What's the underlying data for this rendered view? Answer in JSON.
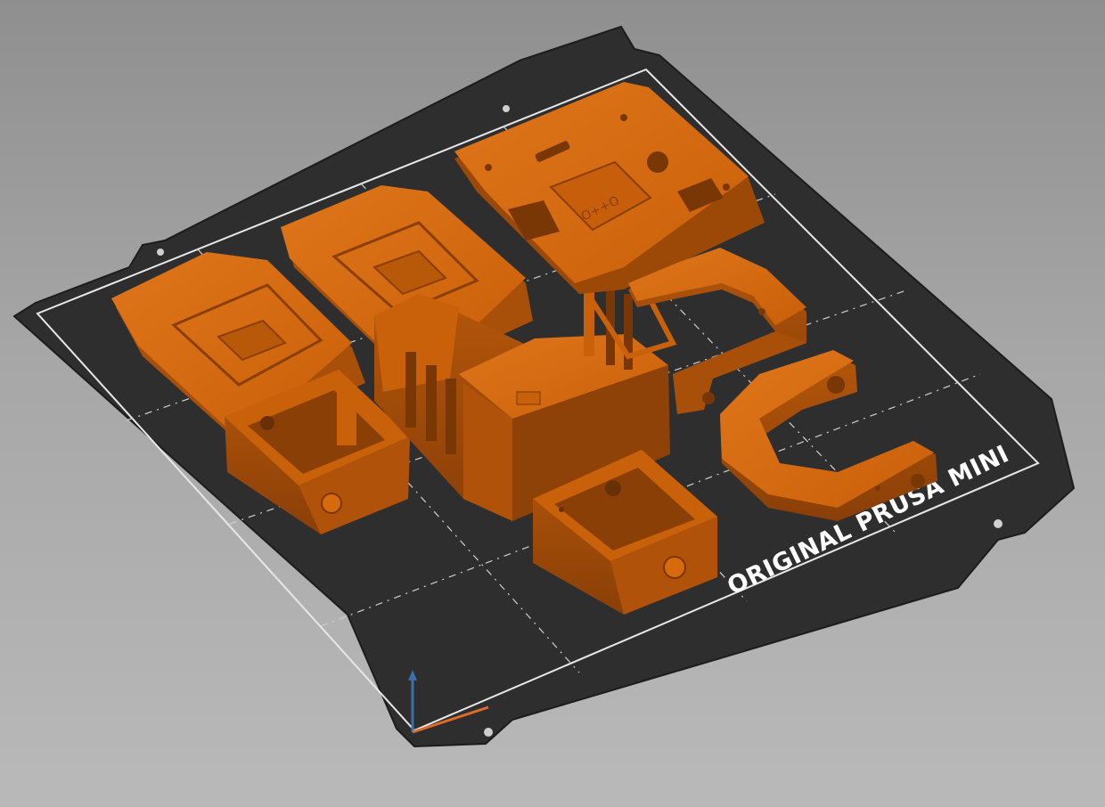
{
  "viewport": {
    "bed_label": "ORIGINAL PRUSA MINI"
  },
  "colors": {
    "background_top": "#8f8f8f",
    "background_bottom": "#b9b9b9",
    "bed_sheet": "#2f2f2f",
    "bed_border": "#e8e8e8",
    "grid_lines": "#d8d8d8",
    "part_top": "#d66a0c",
    "part_side": "#b0520a",
    "part_dark": "#7a3706",
    "axis_z": "#6fa8dc",
    "axis_x": "#e06a2a"
  },
  "icons": {
    "axis_gizmo": "xyz-axis-icon"
  }
}
